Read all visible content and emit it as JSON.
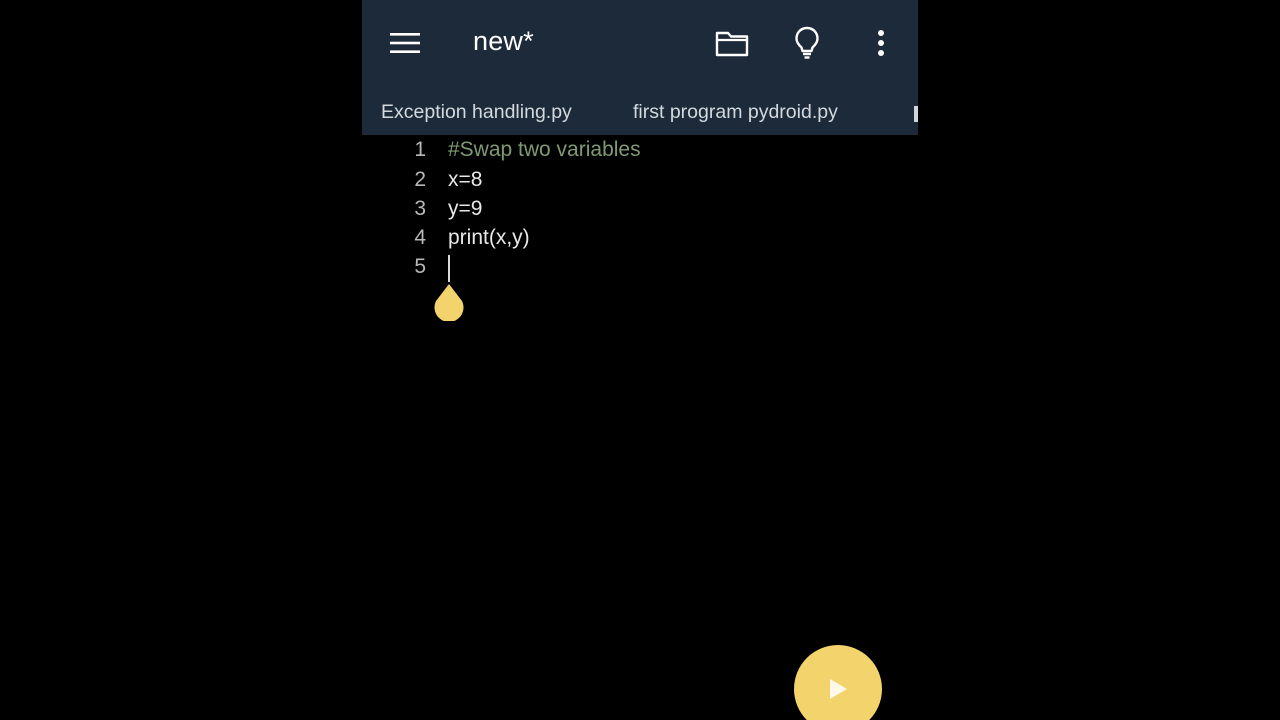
{
  "appbar": {
    "title": "new*",
    "icons": {
      "menu": "hamburger-menu-icon",
      "folder": "folder-icon",
      "tips": "lightbulb-icon",
      "more": "more-vert-icon"
    },
    "background": "#1c2a39"
  },
  "tabs": [
    {
      "label": "Exception handling.py"
    },
    {
      "label": "first program pydroid.py"
    }
  ],
  "editor": {
    "lines": [
      {
        "number": "1",
        "text": "#Swap two variables",
        "kind": "comment"
      },
      {
        "number": "2",
        "text": "x=8",
        "kind": "code"
      },
      {
        "number": "3",
        "text": "y=9",
        "kind": "code"
      },
      {
        "number": "4",
        "text": "print(x,y)",
        "kind": "code"
      },
      {
        "number": "5",
        "text": "",
        "kind": "code"
      }
    ],
    "comment_color": "#7f9a73",
    "text_color": "#e8e8e8"
  },
  "run_button": {
    "icon": "play-icon",
    "color": "#f3d36b"
  }
}
